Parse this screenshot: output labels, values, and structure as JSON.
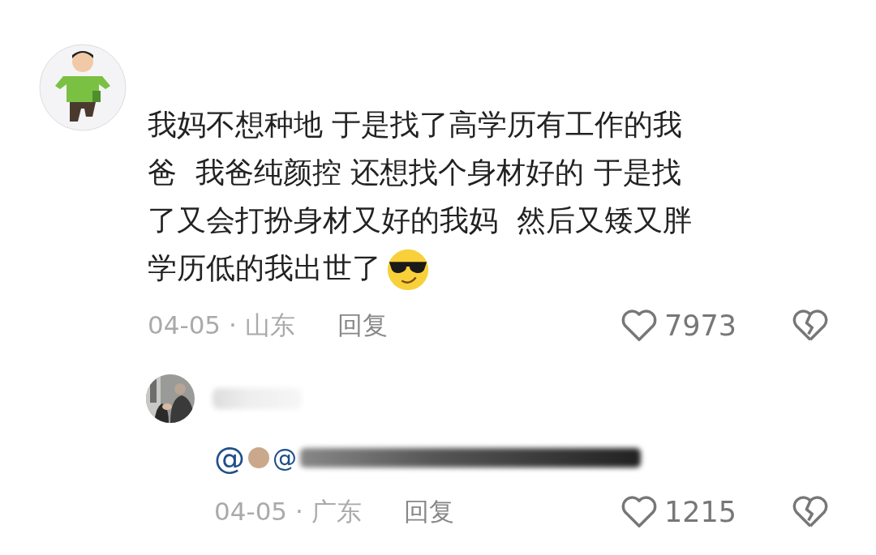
{
  "comments": [
    {
      "kind": "comment",
      "lines": [
        "我妈不想种地 于是找了高学历有工作的我",
        "爸  我爸纯颜控 还想找个身材好的 于是找",
        "了又会打扮身材又好的我妈  然后又矮又胖",
        "学历低的我出世了"
      ],
      "date": "04-05",
      "location": "山东",
      "reply_label": "回复",
      "likes": "7973"
    },
    {
      "kind": "reply",
      "mentions": [
        "@",
        "@"
      ],
      "date": "04-05",
      "location": "广东",
      "reply_label": "回复",
      "likes": "1215"
    }
  ],
  "separator": "·"
}
